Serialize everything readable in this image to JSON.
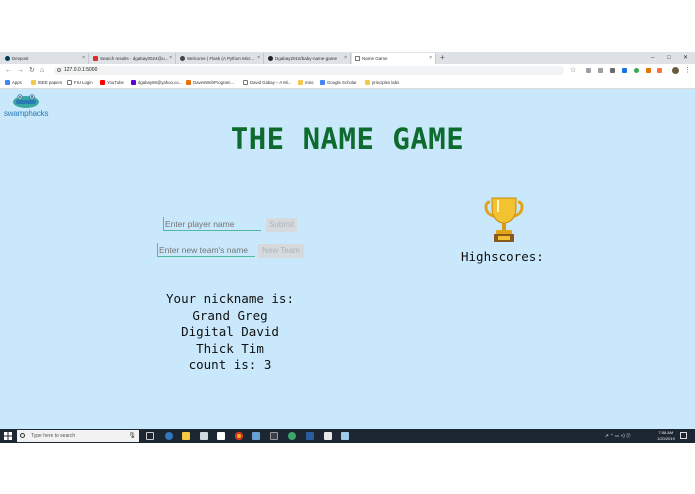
{
  "browser": {
    "tabs": [
      {
        "label": "Devpost"
      },
      {
        "label": "Search results - dgabay0024@u..."
      },
      {
        "label": "Welcome | Flask (A Python Micr..."
      },
      {
        "label": "Dgabay2015/baby-name-game"
      },
      {
        "label": "Name Game"
      }
    ],
    "new_tab": "+",
    "window_controls": {
      "minimize": "–",
      "maximize": "□",
      "close": "✕"
    },
    "url": "127.0.0.1:5000",
    "bookmarks": [
      {
        "label": "Apps",
        "color": "#4285f4"
      },
      {
        "label": "IEEE papers",
        "color": "#f2c94c"
      },
      {
        "label": "FIU Login",
        "color": "#777777"
      },
      {
        "label": "YouTube",
        "color": "#ff0000"
      },
      {
        "label": "dgabay65@yahoo.co...",
        "color": "#6001d2"
      },
      {
        "label": "DavesWebProgram...",
        "color": "#e8710a"
      },
      {
        "label": "David Gabay – A Mi...",
        "color": "#777777"
      },
      {
        "label": "misc",
        "color": "#f2c94c"
      },
      {
        "label": "Google Scholar",
        "color": "#4285f4"
      },
      {
        "label": "principles labs",
        "color": "#f2c94c"
      }
    ]
  },
  "page": {
    "logo_text": "swamphacks",
    "title": "THE NAME GAME",
    "player_input": {
      "placeholder": "Enter player name"
    },
    "submit_label": "Submit",
    "team_input": {
      "placeholder": "Enter new team's name"
    },
    "new_team_label": "New Team",
    "highscores_label": "Highscores:",
    "nickname_heading": "Your nickname is:",
    "names": [
      "Grand Greg",
      "Digital David",
      "Thick Tim"
    ],
    "count_text": "count is: 3"
  },
  "taskbar": {
    "search_placeholder": "Type here to search",
    "time": "7:58 AM",
    "date": "1/20/2019"
  },
  "colors": {
    "background": "#c9e8fb",
    "title": "#0d6b2e",
    "input_border": "#4fb9a4",
    "taskbar": "#1d2733"
  }
}
